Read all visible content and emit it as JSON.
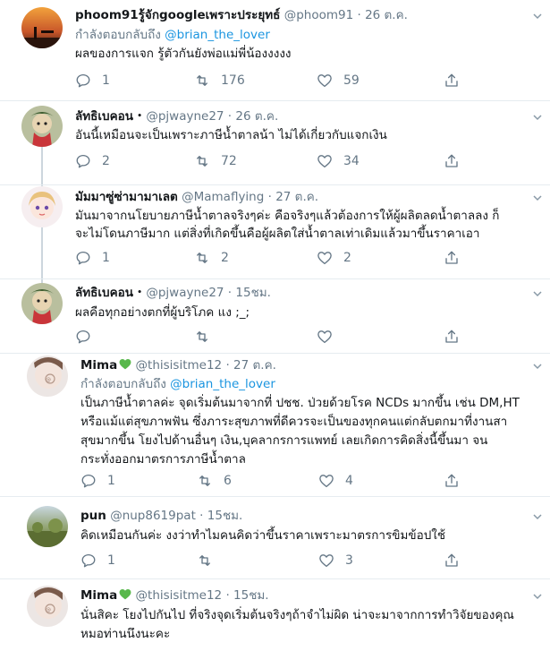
{
  "tweets": [
    {
      "name": "phoom91รู้จักgoogleเพราะประยุทธ์",
      "handle": "@phoom91",
      "date": "26 ต.ค.",
      "reply_prefix": "กำลังตอบกลับถึง",
      "reply_mention": "@brian_the_lover",
      "text_lines": [
        "ผลของการแจก  รู้ตัวกันยังพ่อแม่พี่น้องงงงง"
      ],
      "replies": "1",
      "retweets": "176",
      "likes": "59"
    },
    {
      "name": "ลัทธิเบคอน",
      "handle": "@pjwayne27",
      "date": "26 ต.ค.",
      "text_lines": [
        "อันนี้เหมือนจะเป็นเพราะภาษีน้ำตาลน้า ไม่ได้เกี่ยวกับแจกเงิน"
      ],
      "replies": "2",
      "retweets": "72",
      "likes": "34"
    },
    {
      "name": "มัมมาซู่ซ่ามามาเลต",
      "handle": "@Mamaflying",
      "date": "27 ต.ค.",
      "text_lines": [
        "มันมาจากนโยบายภาษีน้ำตาลจริงๆค่ะ คือจริงๆแล้วต้องการให้ผู้ผลิตลดน้ำตาลลง ก็",
        "จะไม่โดนภาษีมาก แต่สิ่งที่เกิดขึ้นคือผู้ผลิตใส่น้ำตาลเท่าเดิมแล้วมาขึ้นราคาเอา"
      ],
      "replies": "1",
      "retweets": "2",
      "likes": "2"
    },
    {
      "name": "ลัทธิเบคอน",
      "handle": "@pjwayne27",
      "date": "15ชม.",
      "text_lines": [
        "ผลคือทุกอย่างตกที่ผู้บริโภค แง ;_;"
      ],
      "replies": "",
      "retweets": "",
      "likes": ""
    },
    {
      "name": "Mima",
      "handle": "@thisisitme12",
      "date": "27 ต.ค.",
      "reply_prefix": "กำลังตอบกลับถึง",
      "reply_mention": "@brian_the_lover",
      "text_lines": [
        "เป็นภาษีน้ำตาลค่ะ จุดเริ่มต้นมาจากที่ ปชช. ป่วยด้วยโรค NCDs มากขึ้น เช่น DM,HT",
        "หรือแม้แต่สุขภาพฟัน ซึ่งภาระสุขภาพที่ดีควรจะเป็นของทุกคนแต่กลับตกมาที่งานสา",
        "สุขมากขึ้น โยงไปด้านอื่นๆ เงิน,บุคลากรการแพทย์ เลยเกิดการคิดสิ่งนี้ขึ้นมา จน",
        "กระทั่งออกมาตรการภาษีน้ำตาล"
      ],
      "replies": "1",
      "retweets": "6",
      "likes": "4"
    },
    {
      "name": "pun",
      "handle": "@nup8619pat",
      "date": "15ชม.",
      "text_lines": [
        "คิดเหมือนกันค่ะ งงว่าทำไมคนคิดว่าขึ้นราคาเพราะมาตรการขิมข้อปใช้"
      ],
      "replies": "1",
      "retweets": "",
      "likes": "3"
    },
    {
      "name": "Mima",
      "handle": "@thisisitme12",
      "date": "15ชม.",
      "text_lines": [
        "นั่นสิคะ โยงไปกันไป  ที่จริงจุดเริ่มต้นจริงๆถ้าจำไม่ผิด น่าจะมาจากการทำวิจัยของคุณ",
        "หมอท่านนึงนะคะ"
      ]
    }
  ],
  "colors": {
    "link": "#1b95e0",
    "muted": "#657786",
    "divider": "#e6ecf0",
    "heart_green": "#58b84b"
  }
}
